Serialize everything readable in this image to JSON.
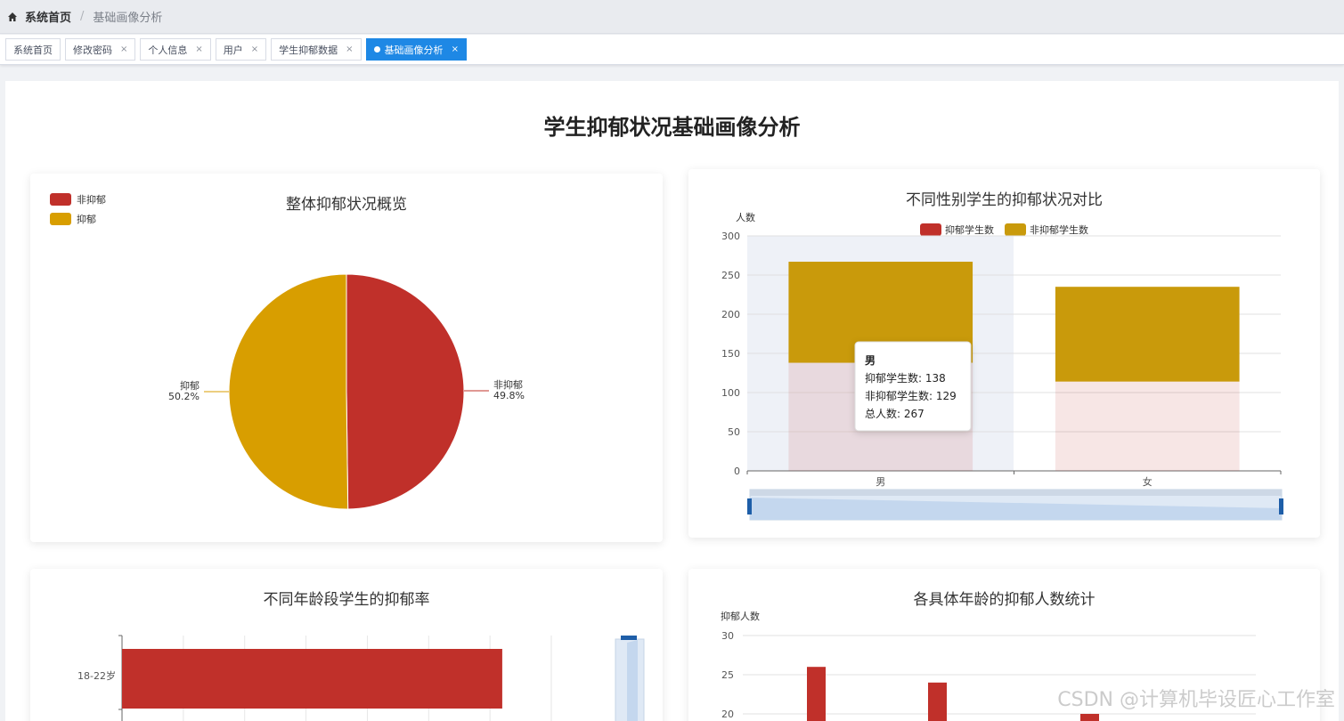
{
  "breadcrumb": {
    "home": "系统首页",
    "separator": "/",
    "current": "基础画像分析"
  },
  "tabs": [
    {
      "label": "系统首页",
      "closable": false,
      "active": false
    },
    {
      "label": "修改密码",
      "closable": true,
      "active": false
    },
    {
      "label": "个人信息",
      "closable": true,
      "active": false
    },
    {
      "label": "用户",
      "closable": true,
      "active": false
    },
    {
      "label": "学生抑郁数据",
      "closable": true,
      "active": false
    },
    {
      "label": "基础画像分析",
      "closable": true,
      "active": true
    }
  ],
  "tab_close_glyph": "×",
  "page_title": "学生抑郁状况基础画像分析",
  "colors": {
    "depressed": "#c0302a",
    "non_depressed": "#d89e00",
    "accent": "#1e88e5"
  },
  "watermark": "CSDN @计算机毕设匠心工作室",
  "chart_data": [
    {
      "type": "pie",
      "title": "整体抑郁状况概览",
      "legend": [
        "非抑郁",
        "抑郁"
      ],
      "legend_position": "top-left",
      "slices": [
        {
          "name": "非抑郁",
          "percent": 49.8,
          "label": "49.8%",
          "color": "#c0302a"
        },
        {
          "name": "抑郁",
          "percent": 50.2,
          "label": "50.2%",
          "color": "#d89e00"
        }
      ]
    },
    {
      "type": "bar",
      "stacked": true,
      "title": "不同性别学生的抑郁状况对比",
      "ylabel": "人数",
      "categories": [
        "男",
        "女"
      ],
      "ylim": [
        0,
        300
      ],
      "yticks": [
        0,
        50,
        100,
        150,
        200,
        250,
        300
      ],
      "legend_position": "top-center",
      "series": [
        {
          "name": "抑郁学生数",
          "values": [
            138,
            114
          ],
          "color": "#c0302a"
        },
        {
          "name": "非抑郁学生数",
          "values": [
            129,
            121
          ],
          "color": "#c99a0b"
        }
      ],
      "emphasis_index": 1,
      "tooltip": {
        "title": "男",
        "lines": [
          "抑郁学生数: 138",
          "非抑郁学生数: 129",
          "总人数: 267"
        ]
      },
      "datazoom": true
    },
    {
      "type": "bar",
      "orientation": "horizontal",
      "title": "不同年龄段学生的抑郁率",
      "categories": [
        "18-22岁"
      ],
      "series": [
        {
          "values": [
            62
          ],
          "color": "#c0302a"
        }
      ],
      "xlim": [
        0,
        70
      ],
      "datazoom": true
    },
    {
      "type": "bar",
      "title": "各具体年龄的抑郁人数统计",
      "ylabel": "抑郁人数",
      "yticks": [
        20,
        25,
        30
      ],
      "ylim": [
        0,
        30
      ],
      "series": [
        {
          "values": [
            26,
            24,
            19,
            20
          ],
          "color": "#c0302a"
        }
      ]
    }
  ]
}
